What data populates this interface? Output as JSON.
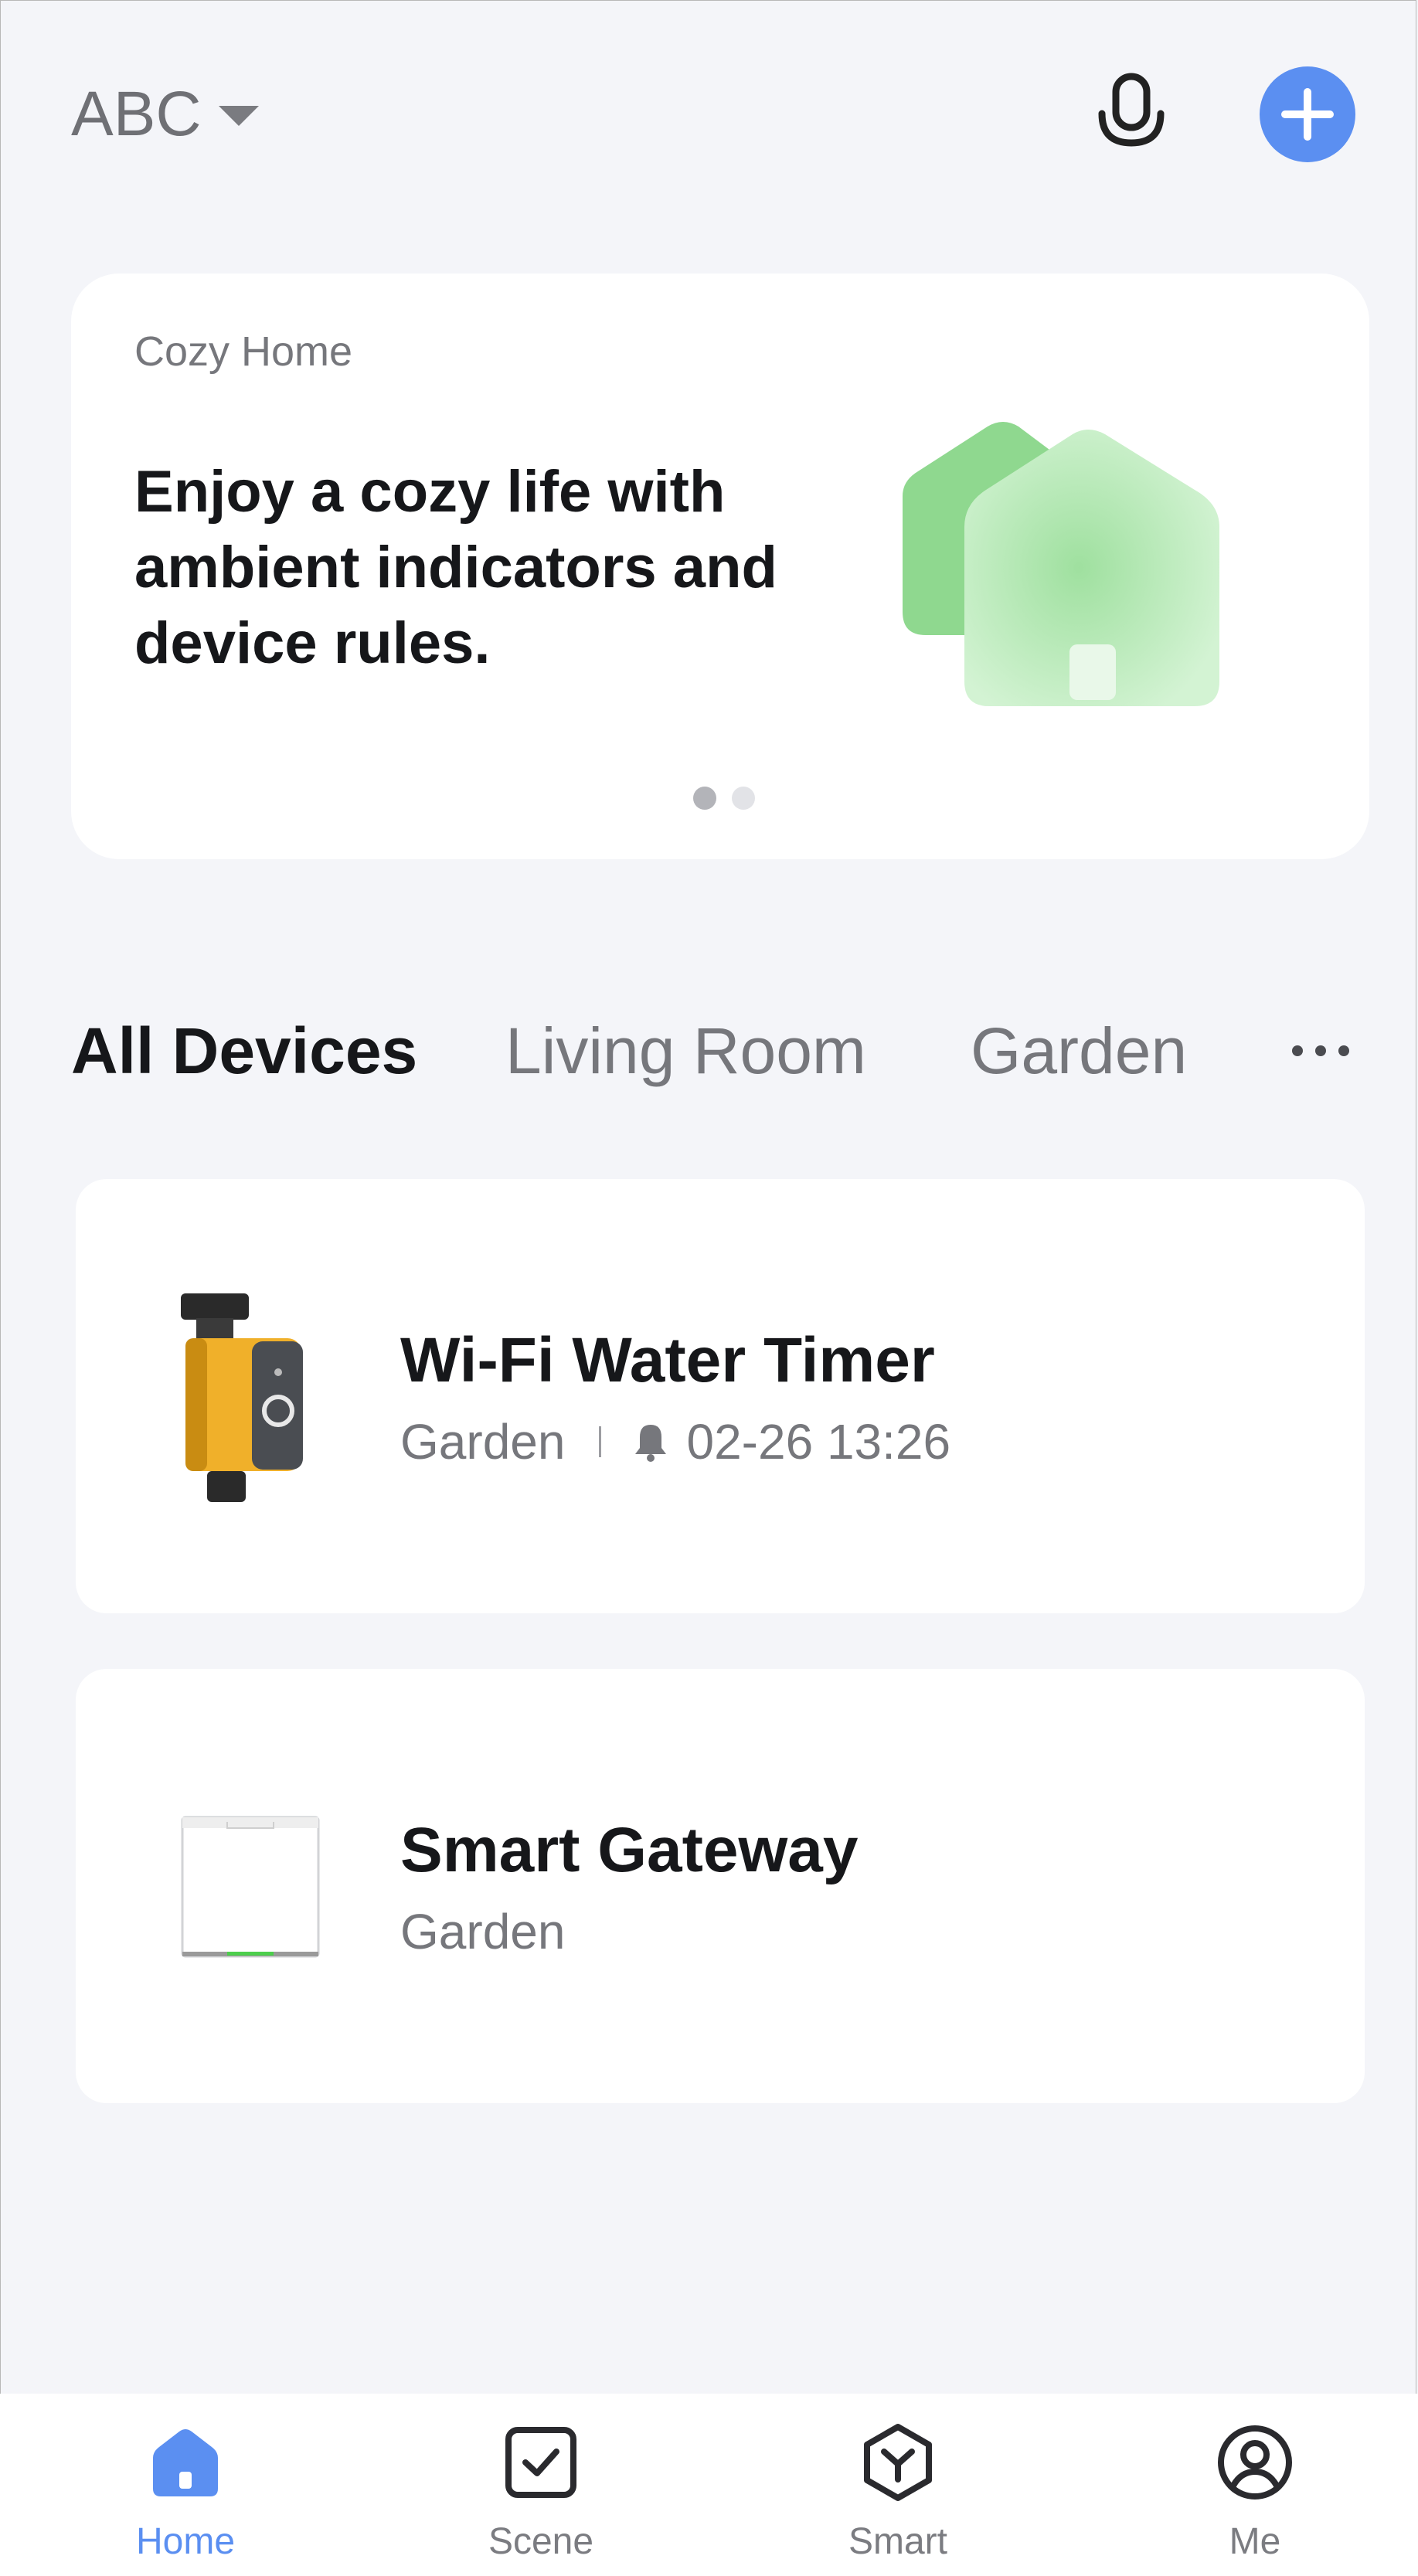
{
  "header": {
    "home_name": "ABC",
    "caret_icon": "caret-down-icon",
    "mic_icon": "microphone-icon",
    "add_icon": "plus-icon",
    "accent_color": "#5b8ff1"
  },
  "banner": {
    "eyebrow": "Cozy Home",
    "headline": "Enjoy a cozy life with ambient indicators and device rules.",
    "illustration": "green-houses-illustration",
    "page_count": 2,
    "active_page": 1
  },
  "tabs": [
    {
      "label": "All Devices",
      "active": true
    },
    {
      "label": "Living Room",
      "active": false
    },
    {
      "label": "Garden",
      "active": false
    }
  ],
  "tabs_more_icon": "more-dots-icon",
  "devices": [
    {
      "name": "Wi-Fi Water Timer",
      "room": "Garden",
      "alarm_icon": "bell-icon",
      "alarm_time": "02-26 13:26",
      "image": "water-timer-device"
    },
    {
      "name": "Smart Gateway",
      "room": "Garden",
      "image": "gateway-device"
    }
  ],
  "bottom_nav": [
    {
      "label": "Home",
      "icon": "home-icon",
      "active": true
    },
    {
      "label": "Scene",
      "icon": "scene-checkbox-icon",
      "active": false
    },
    {
      "label": "Smart",
      "icon": "smart-hexagon-icon",
      "active": false
    },
    {
      "label": "Me",
      "icon": "profile-icon",
      "active": false
    }
  ]
}
